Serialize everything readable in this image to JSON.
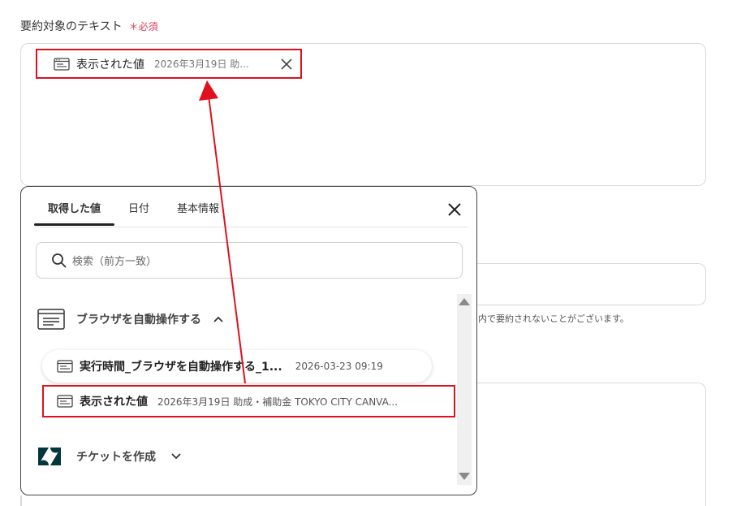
{
  "field": {
    "label": "要約対象のテキスト",
    "required_mark": "＊必須"
  },
  "chip": {
    "name": "表示された値",
    "value": "2026年3月19日 助...",
    "icon": "browser-window-icon"
  },
  "popup": {
    "tabs": [
      {
        "label": "取得した値",
        "active": true
      },
      {
        "label": "日付",
        "active": false
      },
      {
        "label": "基本情報",
        "active": false
      }
    ],
    "search_placeholder": "検索（前方一致）",
    "groups": [
      {
        "label": "ブラウザを自動操作する",
        "expanded": true,
        "icon": "browser-window-icon",
        "items": [
          {
            "name": "実行時間_ブラウザを自動操作する_1...",
            "value": "2026-03-23 09:19"
          },
          {
            "name": "表示された値",
            "value": "2026年3月19日 助成・補助金 TOKYO CITY CANVA..."
          }
        ]
      },
      {
        "label": "チケットを作成",
        "expanded": false,
        "icon": "zendesk-logo-icon"
      }
    ]
  },
  "background": {
    "note": "内で要約されないことがございます。"
  },
  "colors": {
    "highlight": "#e0101f",
    "required": "#e23b5a"
  }
}
